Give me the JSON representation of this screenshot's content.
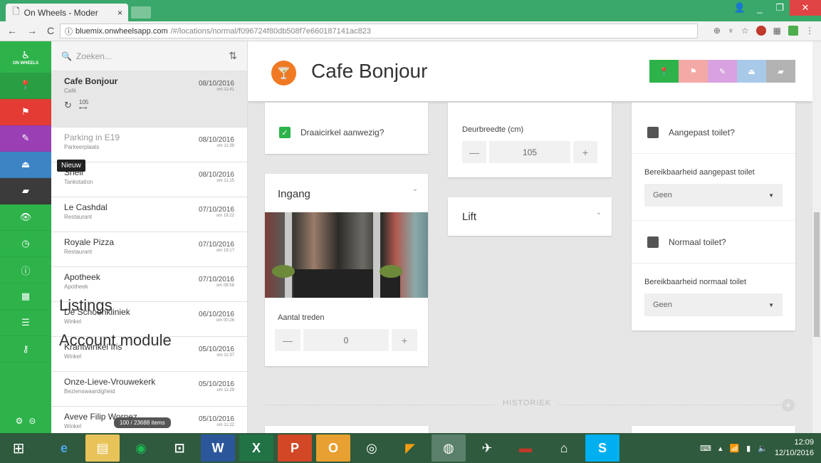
{
  "browser": {
    "tab_title": "On Wheels - Moder",
    "tab_close": "×",
    "url_host": "bluemix.onwheelsapp.com",
    "url_path": "/#/locations/normal/f096724f80db508f7e660187141ac823",
    "back": "←",
    "forward": "→",
    "reload": "C",
    "info": "ⓘ",
    "min": "_",
    "max": "❐",
    "close": "✕"
  },
  "rail": {
    "logo_text": "ON WHEELS",
    "tooltip": "Nieuw"
  },
  "list": {
    "search_placeholder": "Zoeken...",
    "items": [
      {
        "title": "Cafe Bonjour",
        "category": "Café",
        "date": "08/10/2016",
        "time": "om 11:41",
        "meta_value": "105"
      },
      {
        "title": "Parking in E19",
        "category": "Parkeerplaats",
        "date": "08/10/2016",
        "time": "om 11:39"
      },
      {
        "title": "Shell",
        "category": "Tankstation",
        "date": "08/10/2016",
        "time": "om 11:15"
      },
      {
        "title": "Le Cashdal",
        "category": "Restaurant",
        "date": "07/10/2016",
        "time": "om 19:22"
      },
      {
        "title": "Royale Pizza",
        "category": "Restaurant",
        "date": "07/10/2016",
        "time": "om 19:17"
      },
      {
        "title": "Apotheek",
        "category": "Apotheek",
        "date": "07/10/2016",
        "time": "om 08:58"
      },
      {
        "title": "De Schoenkliniek",
        "category": "Winkel",
        "date": "06/10/2016",
        "time": "om 00:26"
      },
      {
        "title": "Krantwinkel Iris",
        "category": "Winkel",
        "date": "05/10/2016",
        "time": "om 11:37"
      },
      {
        "title": "Onze-Lieve-Vrouwekerk",
        "category": "Bezienswaardigheid",
        "date": "05/10/2016",
        "time": "om 11:29"
      },
      {
        "title": "Aveve Filip Wornez",
        "category": "Winkel",
        "date": "05/10/2016",
        "time": "om 11:22"
      }
    ],
    "count_badge": "100 / 23688 items"
  },
  "annotations": {
    "listings": "Listings",
    "account_module": "Account module"
  },
  "main": {
    "title": "Cafe Bonjour",
    "draaicirkel_label": "Draaicirkel aanwezig?",
    "deurbreedte_label": "Deurbreedte (cm)",
    "deurbreedte_value": "105",
    "ingang_title": "Ingang",
    "lift_title": "Lift",
    "aantal_treden_label": "Aantal treden",
    "aantal_treden_value": "0",
    "aangepast_toilet_label": "Aangepast toilet?",
    "bereik_aangepast_label": "Bereikbaarheid aangepast toilet",
    "bereik_aangepast_value": "Geen",
    "normaal_toilet_label": "Normaal toilet?",
    "bereik_normaal_label": "Bereikbaarheid normaal toilet",
    "bereik_normaal_value": "Geen",
    "historiek_label": "HISTORIEK",
    "minus": "—",
    "plus": "+"
  },
  "filter_colors": [
    "#2db34a",
    "#f3a9a6",
    "#d7a2df",
    "#a9c9e8",
    "#b3b3b3"
  ],
  "taskbar": {
    "time": "12:09",
    "date": "12/10/2016"
  }
}
